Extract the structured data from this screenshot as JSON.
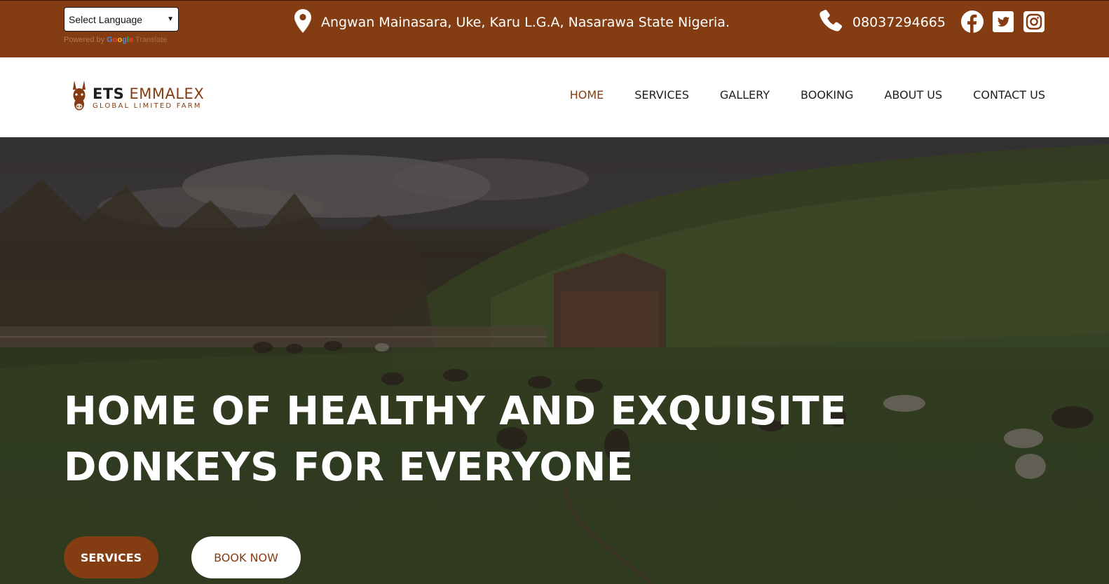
{
  "topbar": {
    "language_select": {
      "value": "Select Language"
    },
    "powered_by": "Powered by",
    "google_letters": [
      "G",
      "o",
      "o",
      "g",
      "l",
      "e"
    ],
    "translate_label": "Translate",
    "address": "Angwan Mainasara, Uke, Karu L.G.A, Nasarawa State Nigeria.",
    "address_icon": "map-pin-icon",
    "phone": "08037294665",
    "phone_icon": "phone-icon",
    "socials": [
      "facebook-icon",
      "twitter-icon",
      "instagram-icon"
    ]
  },
  "brand": {
    "name_part1": "ETS",
    "name_part2": "EMMALEX",
    "tagline": "GLOBAL LIMITED FARM",
    "logo_icon": "donkey-head-icon"
  },
  "nav": {
    "items": [
      {
        "label": "HOME",
        "active": true
      },
      {
        "label": "SERVICES",
        "active": false
      },
      {
        "label": "GALLERY",
        "active": false
      },
      {
        "label": "BOOKING",
        "active": false
      },
      {
        "label": "ABOUT US",
        "active": false
      },
      {
        "label": "CONTACT US",
        "active": false
      }
    ]
  },
  "hero": {
    "title_line1": "HOME OF HEALTHY AND EXQUISITE",
    "title_line2": "DONKEYS FOR EVERYONE",
    "primary_button": "SERVICES",
    "secondary_button": "BOOK NOW"
  },
  "colors": {
    "brand": "#843d12",
    "nav_text": "#1e1e1e",
    "white": "#ffffff"
  }
}
